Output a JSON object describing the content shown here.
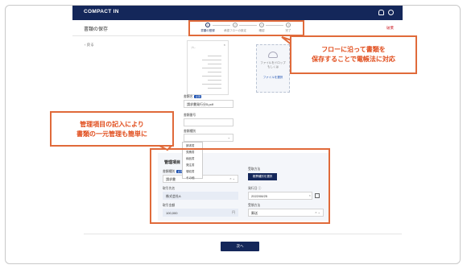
{
  "app": {
    "brand": "COMPACT IN"
  },
  "page": {
    "title": "書類の保存",
    "cancel": "破棄",
    "back": "戻る"
  },
  "steps": [
    {
      "num": "1",
      "label": "書類の登録"
    },
    {
      "num": "2",
      "label": "承認フローの設定"
    },
    {
      "num": "3",
      "label": "確認"
    },
    {
      "num": "4",
      "label": "完了"
    }
  ],
  "document": {
    "tag": "プレ",
    "close": "×"
  },
  "upload": {
    "line1": "ファイルをドロップ",
    "line2": "もしくは",
    "link": "ファイルを選択"
  },
  "form": {
    "filename_label": "書類名",
    "required": "必須",
    "filename_value": "請求書発行分5.pdf",
    "doc_no_label": "書類番号",
    "doc_type_label": "書類種別",
    "doc_type_options": [
      "請求書",
      "見積書",
      "納品書",
      "発注書",
      "領収書",
      "その他"
    ]
  },
  "management": {
    "title": "管理項目",
    "doc_kind_label": "書類種別",
    "doc_kind_value": "請求書",
    "transfer_label": "受取方法",
    "transfer_button": "帳票種別を選択",
    "partner_label": "取引先名",
    "partner_value": "株式会社A",
    "date_label": "発行日",
    "date_value": "2022/08/25",
    "amount_label": "取引金額",
    "amount_value": "100,000",
    "amount_unit": "円",
    "channel_label": "受領方法",
    "channel_value": "郵送"
  },
  "footer": {
    "next": "次へ"
  },
  "callouts": {
    "top": [
      "フローに沿って書類を",
      "保存することで電帳法に対応"
    ],
    "left": [
      "管理項目の記入により",
      "書類の一元管理も簡単に"
    ]
  },
  "colors": {
    "navy": "#14275a",
    "accent": "#e06a3a",
    "accent_text": "#e04b1a"
  }
}
